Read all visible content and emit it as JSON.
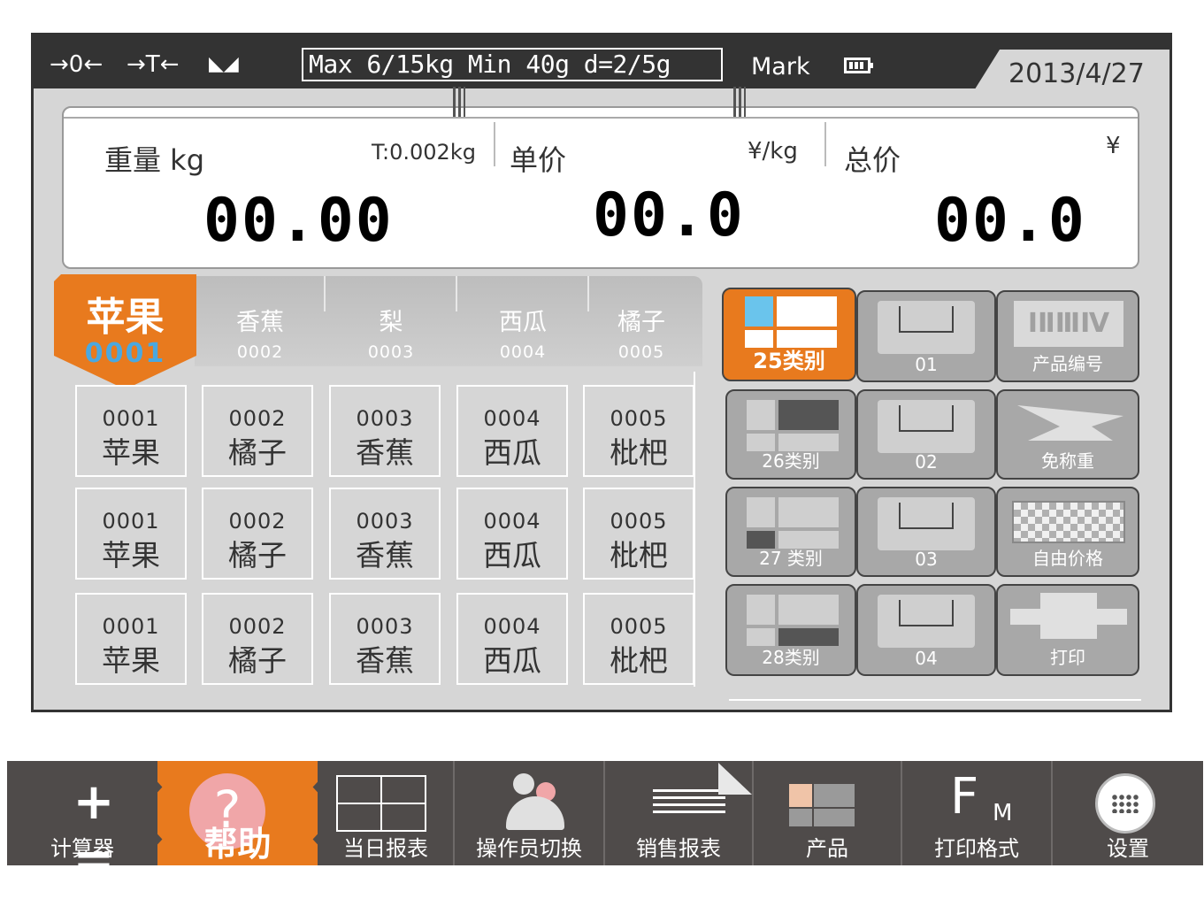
{
  "status": {
    "zero_icon": "→0←",
    "tare_icon": "→T←",
    "stable_icon": "◣◢",
    "spec": "Max 6/15kg  Min 40g  d=2/5g",
    "mark": "Mark",
    "date": "2013/4/27"
  },
  "display": {
    "weight_label": "重量  kg",
    "tare": "T:0.002kg",
    "weight_value": "00.00",
    "price_label": "单价",
    "price_unit": "¥/kg",
    "price_value": "00.0",
    "total_label": "总价",
    "total_unit": "¥",
    "total_value": "00.0"
  },
  "tabs": [
    {
      "name": "苹果",
      "code": "0001"
    },
    {
      "name": "香蕉",
      "code": "0002"
    },
    {
      "name": "梨",
      "code": "0003"
    },
    {
      "name": "西瓜",
      "code": "0004"
    },
    {
      "name": "橘子",
      "code": "0005"
    }
  ],
  "products": [
    [
      {
        "code": "0001",
        "name": "苹果"
      },
      {
        "code": "0002",
        "name": "橘子"
      },
      {
        "code": "0003",
        "name": "香蕉"
      },
      {
        "code": "0004",
        "name": "西瓜"
      },
      {
        "code": "0005",
        "name": "枇杷"
      }
    ],
    [
      {
        "code": "0001",
        "name": "苹果"
      },
      {
        "code": "0002",
        "name": "橘子"
      },
      {
        "code": "0003",
        "name": "香蕉"
      },
      {
        "code": "0004",
        "name": "西瓜"
      },
      {
        "code": "0005",
        "name": "枇杷"
      }
    ],
    [
      {
        "code": "0001",
        "name": "苹果"
      },
      {
        "code": "0002",
        "name": "橘子"
      },
      {
        "code": "0003",
        "name": "香蕉"
      },
      {
        "code": "0004",
        "name": "西瓜"
      },
      {
        "code": "0005",
        "name": "枇杷"
      }
    ]
  ],
  "side_buttons": {
    "cat25": "25类别",
    "cat26": "26类别",
    "cat27": "27 类别",
    "cat28": "28类别",
    "bin1": "01",
    "bin2": "02",
    "bin3": "03",
    "bin4": "04",
    "roman": "ⅠⅡⅢⅣ",
    "product_code": "产品编号",
    "no_weigh": "免称重",
    "free_price": "自由价格",
    "print": "打印"
  },
  "toolbar": {
    "calculator_symbols": "+ =",
    "calculator": "计算器",
    "help_icon": "?",
    "help": "帮助",
    "daily_report": "当日报表",
    "operator_switch": "操作员切换",
    "sales_report": "销售报表",
    "products": "产品",
    "print_format_f": "F",
    "print_format_m": "M",
    "print_format": "打印格式",
    "settings": "设置"
  },
  "colors": {
    "accent": "#e87a1e",
    "dark": "#333333",
    "toolbar": "#4f4b4a",
    "code_blue": "#4aa8e0"
  }
}
